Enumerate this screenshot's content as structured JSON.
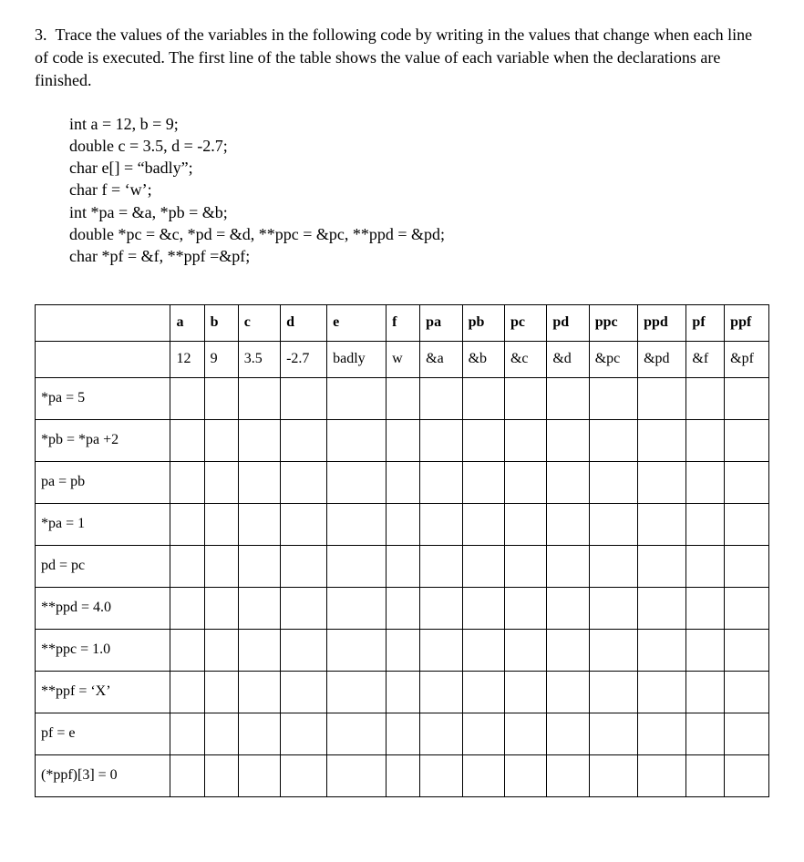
{
  "question": {
    "number": "3.",
    "text": "Trace the values of the variables in the following code by writing in the values that change when each line of code is executed. The first line of the table shows the value of each variable when the declarations are finished."
  },
  "code_lines": [
    "int a = 12, b = 9;",
    "double c = 3.5, d = -2.7;",
    "char e[] = “badly”;",
    "char f = ‘w’;",
    "int *pa = &a, *pb = &b;",
    "double *pc = &c, *pd = &d, **ppc = &pc, **ppd = &pd;",
    "char *pf = &f, **ppf =&pf;"
  ],
  "table": {
    "headers": [
      "",
      "a",
      "b",
      "c",
      "d",
      "e",
      "f",
      "pa",
      "pb",
      "pc",
      "pd",
      "ppc",
      "ppd",
      "pf",
      "ppf"
    ],
    "initial": [
      "",
      "12",
      "9",
      "3.5",
      "-2.7",
      "badly",
      "w",
      "&a",
      "&b",
      "&c",
      "&d",
      "&pc",
      "&pd",
      "&f",
      "&pf"
    ],
    "rows": [
      "*pa = 5",
      "*pb = *pa +2",
      "pa = pb",
      "*pa = 1",
      "pd = pc",
      "**ppd = 4.0",
      "**ppc = 1.0",
      "**ppf = ‘X’",
      "pf = e",
      "(*ppf)[3] = 0"
    ]
  }
}
